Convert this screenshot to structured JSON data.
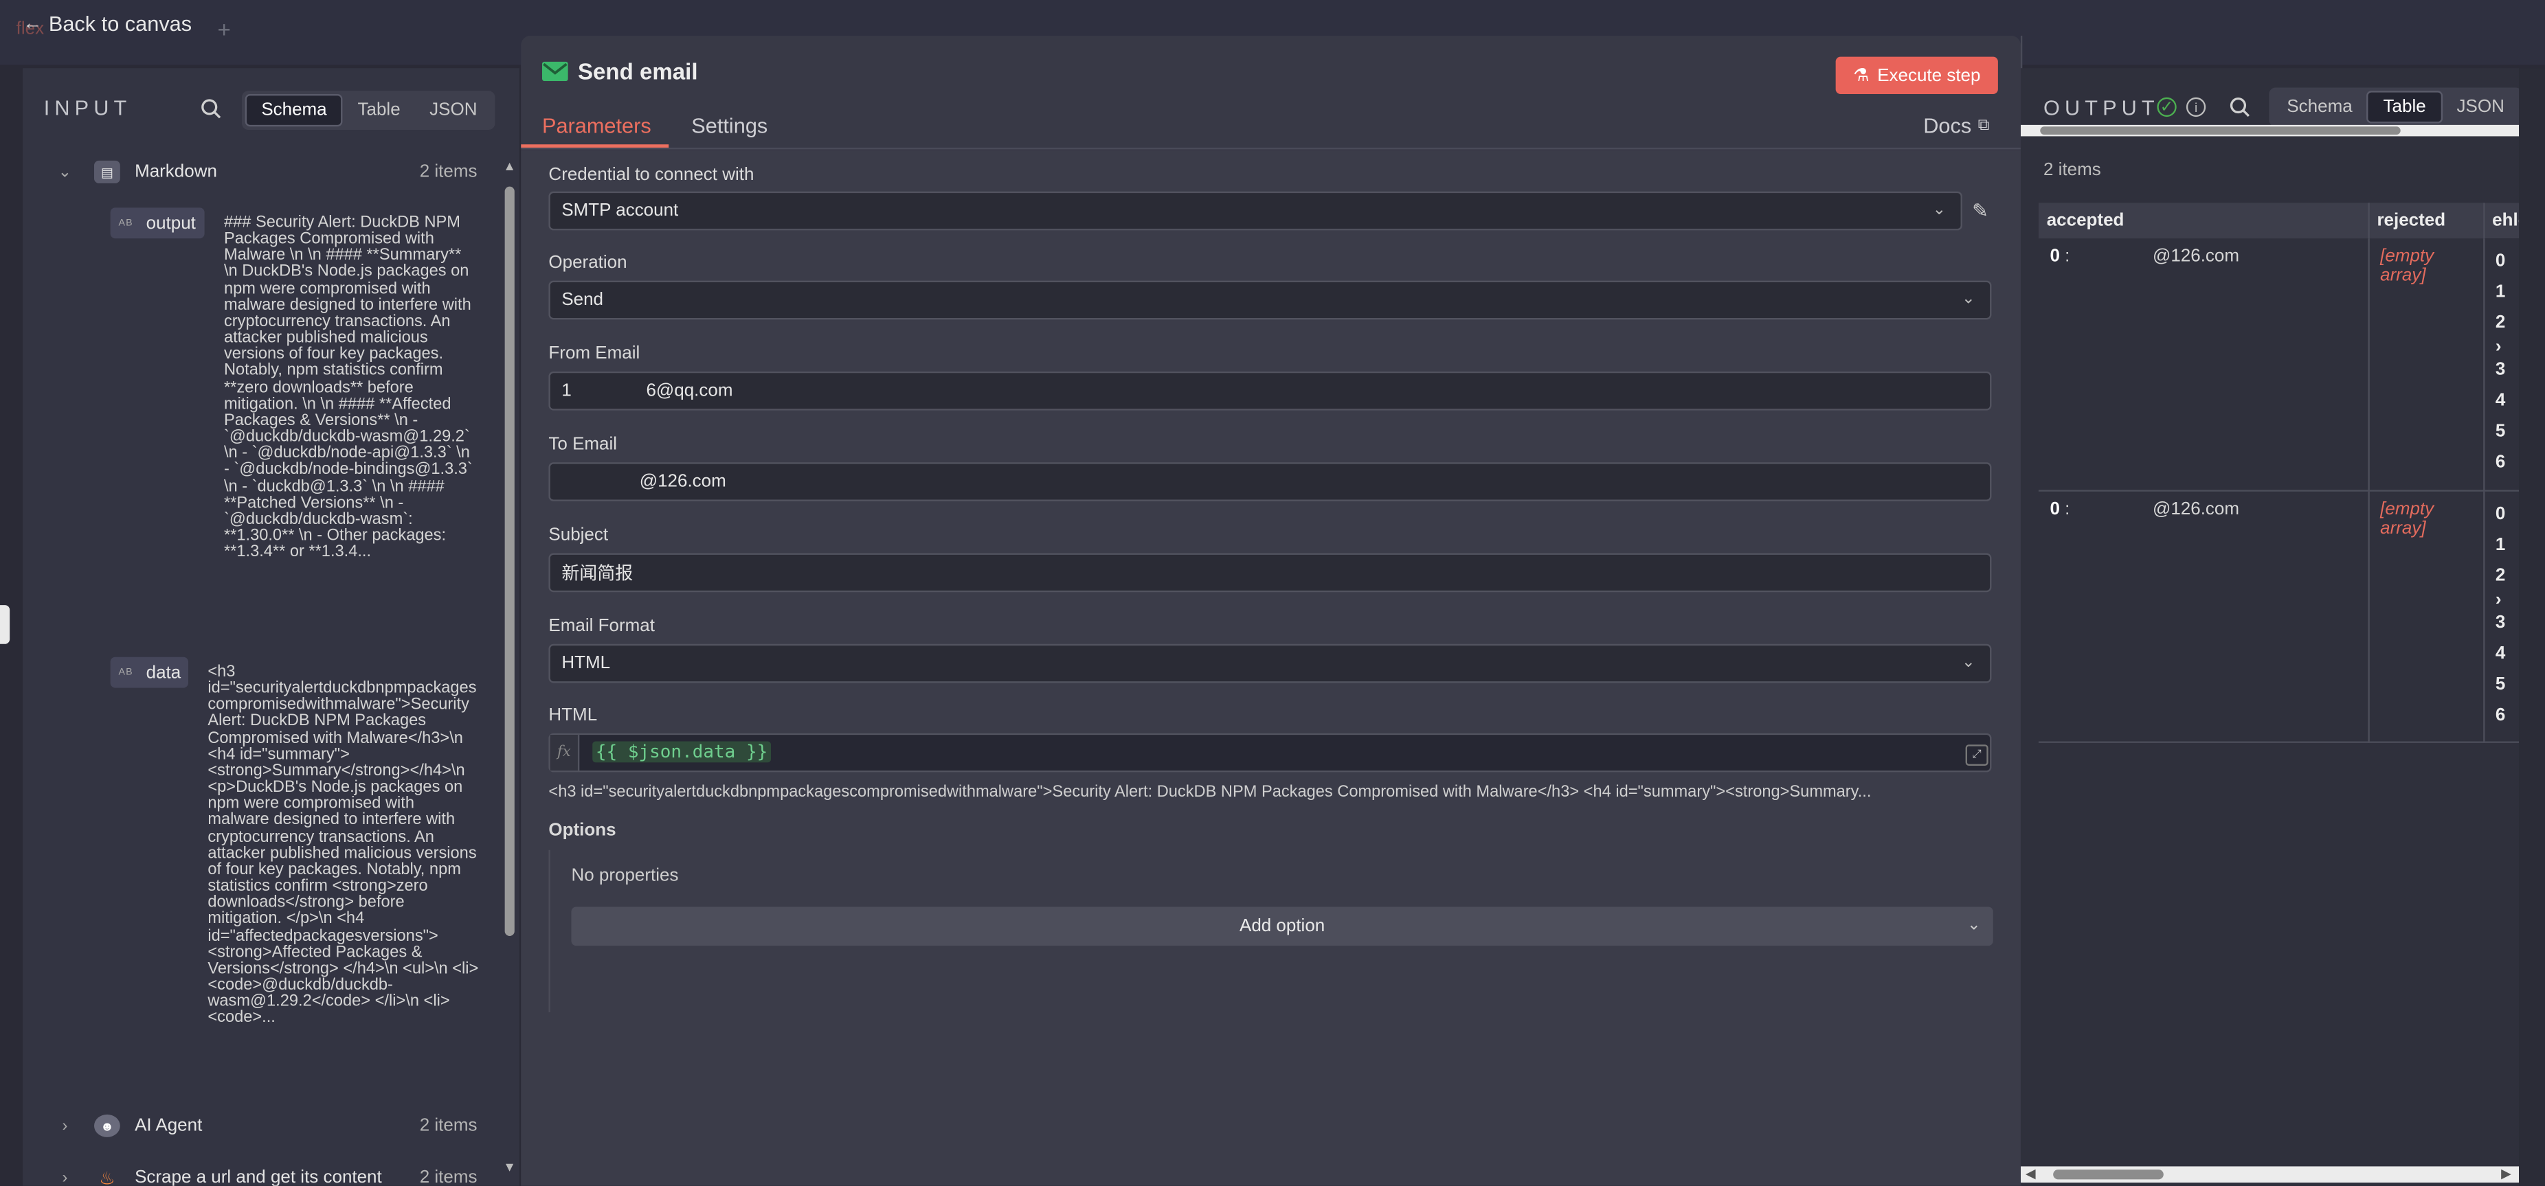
{
  "topbar": {
    "back_label": "Back to canvas",
    "back_icon": "arrow-left-icon",
    "ghost_tab": "flex",
    "ghost_plus": "+"
  },
  "input": {
    "title": "INPUT",
    "view_tabs": [
      "Schema",
      "Table",
      "JSON"
    ],
    "active_view": "Schema",
    "nodes": [
      {
        "name": "Markdown",
        "count": "2 items",
        "icon": "markdown-icon",
        "expanded": true,
        "fields": [
          {
            "name": "output",
            "type_badge": "AB",
            "value": "### Security Alert: DuckDB NPM Packages Compromised with Malware \\n \\n #### **Summary** \\n DuckDB's Node.js packages on npm were compromised with malware designed to interfere with cryptocurrency transactions. An attacker published malicious versions of four key packages. Notably, npm statistics confirm **zero downloads** before mitigation. \\n \\n #### **Affected Packages & Versions** \\n - `@duckdb/duckdb-wasm@1.29.2` \\n - `@duckdb/node-api@1.3.3` \\n - `@duckdb/node-bindings@1.3.3` \\n - `duckdb@1.3.3` \\n \\n #### **Patched Versions** \\n - `@duckdb/duckdb-wasm`: **1.30.0** \\n - Other packages: **1.3.4** or **1.3.4..."
          },
          {
            "name": "data",
            "type_badge": "AB",
            "value": "<h3 id=\"securityalertduckdbnpmpackagescompromisedwithmalware\">Security Alert: DuckDB NPM Packages Compromised with Malware</h3>\\n <h4 id=\"summary\"> <strong>Summary</strong></h4>\\n <p>DuckDB's Node.js packages on npm were compromised with malware designed to interfere with cryptocurrency transactions. An attacker published malicious versions of four key packages. Notably, npm statistics confirm <strong>zero downloads</strong> before mitigation. </p>\\n <h4 id=\"affectedpackagesversions\"> <strong>Affected Packages & Versions</strong> </h4>\\n <ul>\\n <li> <code>@duckdb/duckdb-wasm@1.29.2</code> </li>\\n <li> <code>..."
          }
        ]
      },
      {
        "name": "AI Agent",
        "count": "2 items",
        "icon": "robot-icon",
        "expanded": false
      },
      {
        "name": "Scrape a url and get its content",
        "count": "2 items",
        "icon": "fire-icon",
        "expanded": false
      }
    ]
  },
  "modal": {
    "title": "Send email",
    "title_icon": "envelope-icon",
    "execute_label": "Execute step",
    "execute_icon": "flask-icon",
    "tabs": [
      "Parameters",
      "Settings"
    ],
    "active_tab": "Parameters",
    "docs_label": "Docs",
    "fields": {
      "credential": {
        "label": "Credential to connect with",
        "value": "SMTP account"
      },
      "operation": {
        "label": "Operation",
        "value": "Send"
      },
      "from_email": {
        "label": "From Email",
        "value_prefix": "1",
        "value_suffix": "6@qq.com"
      },
      "to_email": {
        "label": "To Email",
        "value_suffix": "@126.com"
      },
      "subject": {
        "label": "Subject",
        "value": "新闻简报"
      },
      "email_format": {
        "label": "Email Format",
        "value": "HTML"
      },
      "html": {
        "label": "HTML",
        "fx": "fx",
        "expression": "{{ $json.data }}",
        "preview": "<h3 id=\"securityalertduckdbnpmpackagescompromisedwithmalware\">Security Alert: DuckDB NPM Packages Compromised with Malware</h3> <h4 id=\"summary\"><strong>Summary..."
      }
    },
    "options": {
      "label": "Options",
      "empty_text": "No properties",
      "add_label": "Add option"
    }
  },
  "output": {
    "title": "OUTPUT",
    "status": "success",
    "view_tabs": [
      "Schema",
      "Table",
      "JSON"
    ],
    "active_view": "Table",
    "count": "2 items",
    "columns": [
      "accepted",
      "rejected",
      "ehlo"
    ],
    "rows": [
      {
        "accepted_index": "0",
        "accepted_suffix": "@126.com",
        "rejected": "[empty array]",
        "ehlo_indices": [
          "0",
          "1",
          "2",
          "",
          "3",
          "4",
          "5",
          "6"
        ]
      },
      {
        "accepted_index": "0",
        "accepted_suffix": "@126.com",
        "rejected": "[empty array]",
        "ehlo_indices": [
          "0",
          "1",
          "2",
          "",
          "3",
          "4",
          "5",
          "6"
        ]
      }
    ]
  },
  "colors": {
    "accent": "#ec6f5f",
    "execute": "#e9635a",
    "success": "#4caf50",
    "expression": "#6fcf8e"
  }
}
